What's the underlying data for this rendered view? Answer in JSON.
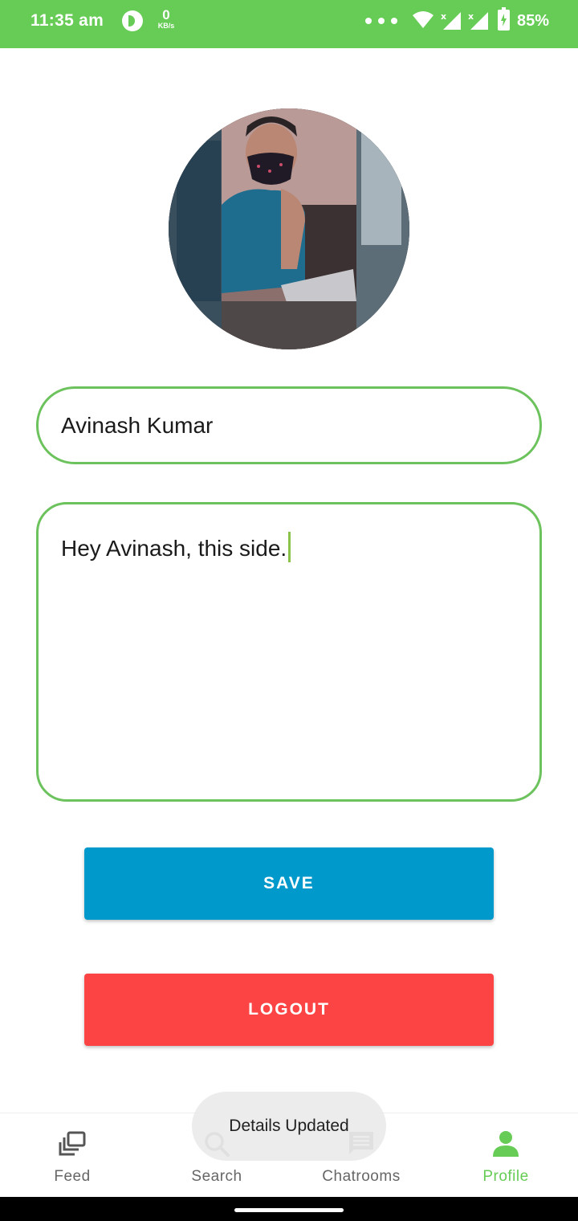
{
  "status_bar": {
    "time": "11:35 am",
    "net_speed_value": "0",
    "net_speed_unit": "KB/s",
    "battery": "85%",
    "background_color": "#66cc55",
    "icons": [
      "app-notification-icon",
      "more-dots-icon",
      "wifi-icon",
      "signal-icon",
      "signal-icon",
      "battery-charging-icon"
    ]
  },
  "profile": {
    "avatar": "profile-photo",
    "name_value": "Avinash Kumar",
    "bio_value": "Hey Avinash, this side."
  },
  "actions": {
    "save_label": "SAVE",
    "logout_label": "LOGOUT",
    "save_color": "#0099cc",
    "logout_color": "#fc4444"
  },
  "toast": {
    "message": "Details Updated"
  },
  "bottom_nav": {
    "items": [
      {
        "label": "Feed",
        "icon": "feed-icon",
        "active": false
      },
      {
        "label": "Search",
        "icon": "search-icon",
        "active": false
      },
      {
        "label": "Chatrooms",
        "icon": "chat-icon",
        "active": false
      },
      {
        "label": "Profile",
        "icon": "person-icon",
        "active": true
      }
    ],
    "active_color": "#66cc55",
    "inactive_color": "#666666"
  }
}
